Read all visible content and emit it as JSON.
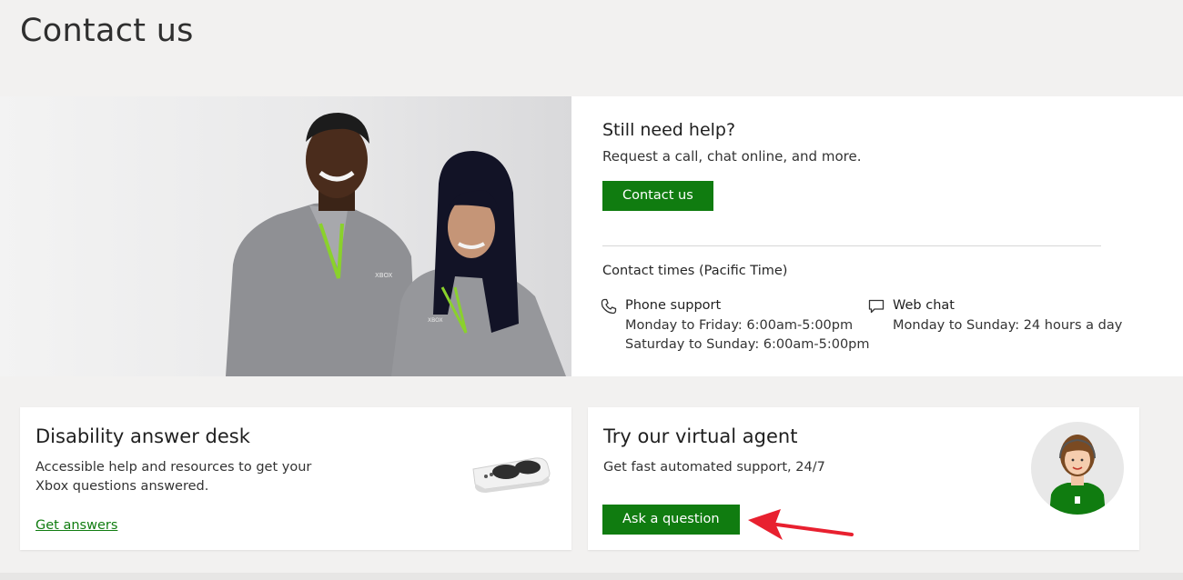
{
  "page": {
    "title": "Contact us"
  },
  "hero": {
    "title": "Still need help?",
    "subtitle": "Request a call, chat online, and more.",
    "button_label": "Contact us",
    "contact_times_title": "Contact times (Pacific Time)",
    "phone": {
      "icon": "phone-icon",
      "label": "Phone support",
      "line1": "Monday to Friday: 6:00am-5:00pm",
      "line2": "Saturday to Sunday: 6:00am-5:00pm"
    },
    "chat": {
      "icon": "chat-bubble-icon",
      "label": "Web chat",
      "line1": "Monday to Sunday: 24 hours a day"
    },
    "shirt_logo": "XBOX"
  },
  "disability": {
    "title": "Disability answer desk",
    "description": "Accessible help and resources to get your Xbox questions answered.",
    "link_label": "Get answers",
    "image": "adaptive-controller-image"
  },
  "virtual_agent": {
    "title": "Try our virtual agent",
    "description": "Get fast automated support, 24/7",
    "button_label": "Ask a question",
    "image": "agent-avatar"
  },
  "colors": {
    "brand_green": "#107c10",
    "page_bg": "#f2f1f0",
    "arrow_red": "#e8202f"
  }
}
